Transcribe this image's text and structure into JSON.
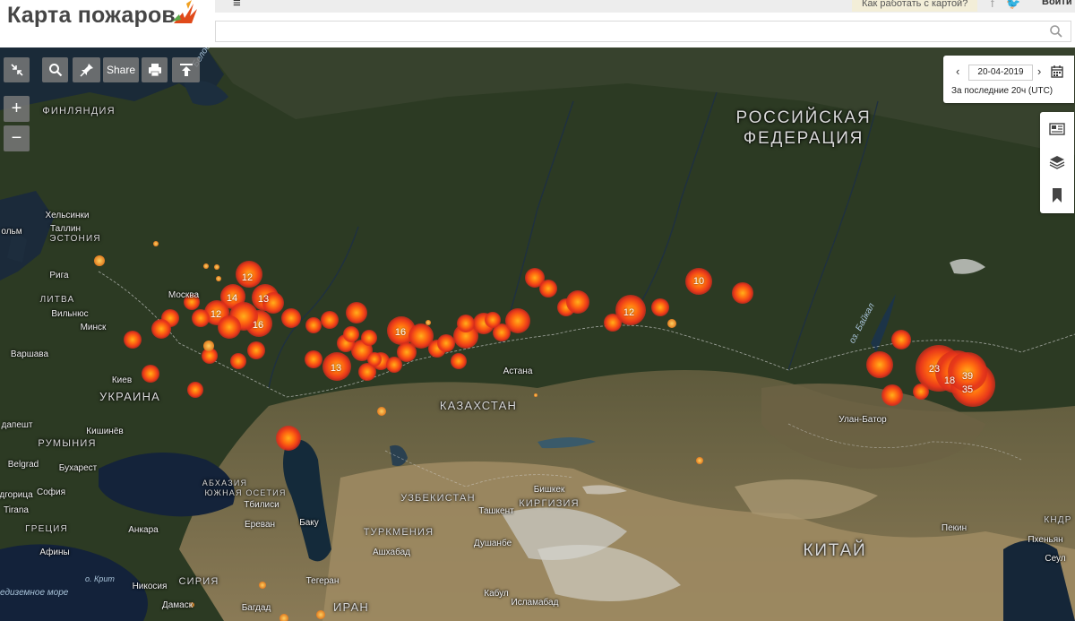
{
  "header": {
    "logo_text": "Карта пожаров",
    "menu_icon": "≡",
    "help_link": "Как работать с картой?",
    "login": "Войти",
    "search_placeholder": ""
  },
  "toolbar": {
    "share_label": "Share"
  },
  "zoom": {
    "in": "+",
    "out": "−"
  },
  "date_panel": {
    "prev": "‹",
    "date": "20-04-2019",
    "next": "›",
    "period": "За последние 20ч (UTC)"
  },
  "map": {
    "countries": {
      "russia_1": "РОССИЙСКАЯ",
      "russia_2": "ФЕДЕРАЦИЯ",
      "kazakhstan": "КАЗАХСТАН",
      "china": "КИТАЙ",
      "ukraine": "УКРАИНА",
      "finland": "ФИНЛЯНДИЯ",
      "estonia": "ЭСТОНИЯ",
      "latvia": "ЛИТВА",
      "romania": "РУМЫНИЯ",
      "uzbekistan": "УЗБЕКИСТАН",
      "turkmenia": "ТУРКМЕНИЯ",
      "kyrgyzstan": "КИРГИЗИЯ",
      "iran": "ИРАН",
      "syria": "СИРИЯ",
      "greece": "ГРЕЦИЯ",
      "abkhazia": "АБХАЗИЯ",
      "south_ossetia": "ЮЖНАЯ ОСЕТИЯ",
      "kndr": "КНДР"
    },
    "cities": {
      "helsinki": "Хельсинки",
      "tallinn": "Таллин",
      "stockholm": "ольм",
      "riga": "Рига",
      "vilnius": "Вильнюс",
      "minsk": "Минск",
      "warsaw": "Варшава",
      "kiev": "Киев",
      "moscow": "Москва",
      "budapest": "дапешт",
      "chisinau": "Кишинёв",
      "belgrade": "Belgrad",
      "bucharest": "Бухарест",
      "sofia": "София",
      "podgorica": "дгорица",
      "tirana": "Tirana",
      "athens": "Афины",
      "tbilisi": "Тбилиси",
      "yerevan": "Ереван",
      "baku": "Баку",
      "ankara": "Анкара",
      "astana": "Астана",
      "bishkek": "Бишкек",
      "tashkent": "Ташкент",
      "dushanbe": "Душанбе",
      "ashgabat": "Ашхабад",
      "tehran": "Тегеран",
      "nicosia": "Никосия",
      "damascus": "Дамаск",
      "baghdad": "Багдад",
      "kabul": "Кабул",
      "islamabad": "Исламабад",
      "ulaanbaatar": "Улан-Батор",
      "beijing": "Пекин",
      "pyongyang": "Пхеньян",
      "seoul": "Сеул"
    },
    "water": {
      "white_sea": "Белое море",
      "baikal": "оз. Байкал",
      "med_sea": "едиземное море",
      "crete": "о. Крит"
    },
    "fire_counts": [
      "12",
      "14",
      "13",
      "12",
      "16",
      "16",
      "13",
      "12",
      "10",
      "23",
      "39",
      "18",
      "35"
    ]
  }
}
